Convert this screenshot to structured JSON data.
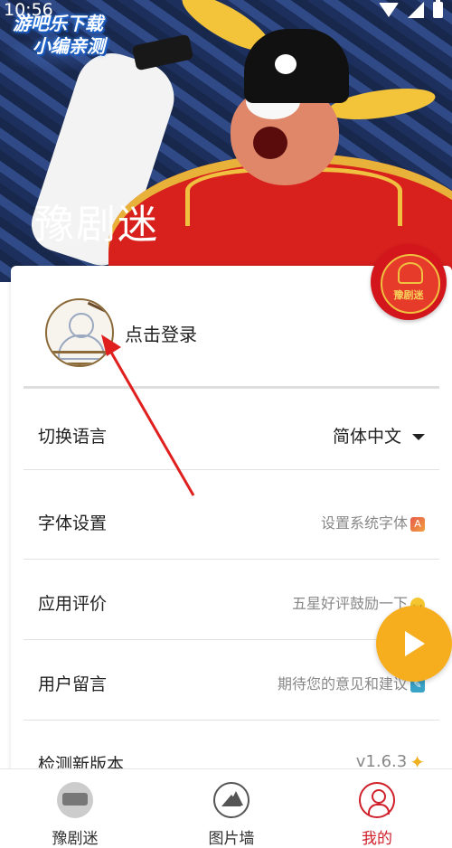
{
  "status_bar": {
    "time": "10:56"
  },
  "banner": {
    "watermark_line1": "游吧乐下载",
    "watermark_line2": "小编亲测",
    "title": "豫剧迷"
  },
  "logo_badge": {
    "text": "豫剧迷"
  },
  "profile": {
    "login_text": "点击登录"
  },
  "settings": [
    {
      "id": "language",
      "label": "切换语言",
      "value": "简体中文"
    },
    {
      "id": "font",
      "label": "字体设置",
      "value": "设置系统字体"
    },
    {
      "id": "rate",
      "label": "应用评价",
      "value": "五星好评鼓励一下"
    },
    {
      "id": "feedback",
      "label": "用户留言",
      "value": "期待您的意见和建议"
    },
    {
      "id": "update",
      "label": "检测新版本",
      "value": "v1.6.3"
    }
  ],
  "nav": {
    "items": [
      {
        "label": "豫剧迷",
        "icon": "app-logo-icon",
        "active": false
      },
      {
        "label": "图片墙",
        "icon": "picture-icon",
        "active": false
      },
      {
        "label": "我的",
        "icon": "user-icon",
        "active": true
      }
    ]
  },
  "colors": {
    "accent": "#d0202a",
    "fab": "#f6ae1e",
    "annotation_arrow": "#e0201e"
  }
}
